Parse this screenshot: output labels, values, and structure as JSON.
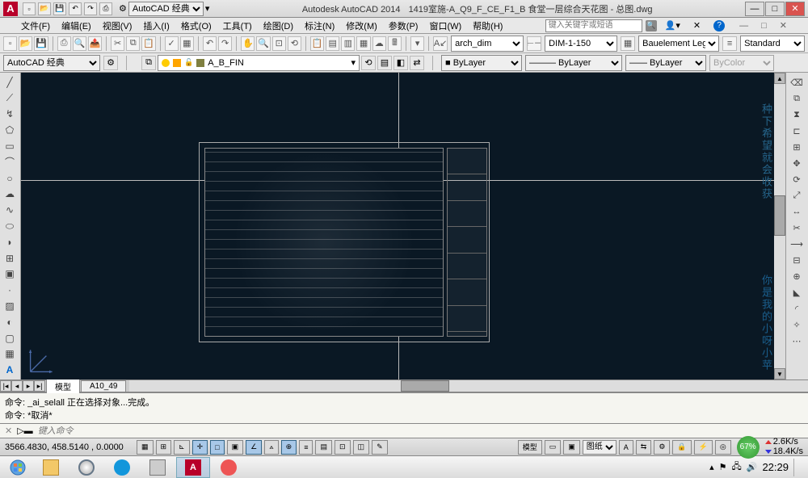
{
  "app": {
    "title_prefix": "Autodesk AutoCAD 2014",
    "document": "1419室施-A_Q9_F_CE_F1_B 食堂一层综合天花图 - 总图.dwg",
    "workspace": "AutoCAD 经典"
  },
  "menu": [
    "文件(F)",
    "编辑(E)",
    "视图(V)",
    "插入(I)",
    "格式(O)",
    "工具(T)",
    "绘图(D)",
    "标注(N)",
    "修改(M)",
    "参数(P)",
    "窗口(W)",
    "帮助(H)"
  ],
  "search_placeholder": "键入关键字或短语",
  "style_toolbar": {
    "text_style": "arch_dim",
    "dim_style": "DIM-1-150",
    "table_style": "Bauelement Leg",
    "ml_style": "Standard"
  },
  "workspace2": "AutoCAD 经典",
  "layer": {
    "current": "A_B_FIN",
    "color": "#808040"
  },
  "properties": {
    "color": "ByLayer",
    "color_swatch": "#ffffff",
    "linetype": "ByLayer",
    "lineweight": "ByLayer",
    "plotstyle": "ByColor"
  },
  "tabs": {
    "model": "模型",
    "layout": "A10_49"
  },
  "command": {
    "line1": "命令: _ai_selall 正在选择对象...完成。",
    "line2": "命令: *取消*",
    "prompt_icon": "✕",
    "placeholder": "键入命令"
  },
  "status": {
    "coords": "3566.4830, 458.5140 , 0.0000",
    "scale": "图纸",
    "disk": "67%",
    "net_up": "2.6K/s",
    "net_down": "18.4K/s"
  },
  "watermarks": {
    "w1": "种下希望就会收获",
    "w2": "你是我的小呀小苹"
  },
  "taskbar": {
    "clock": "22:29"
  }
}
